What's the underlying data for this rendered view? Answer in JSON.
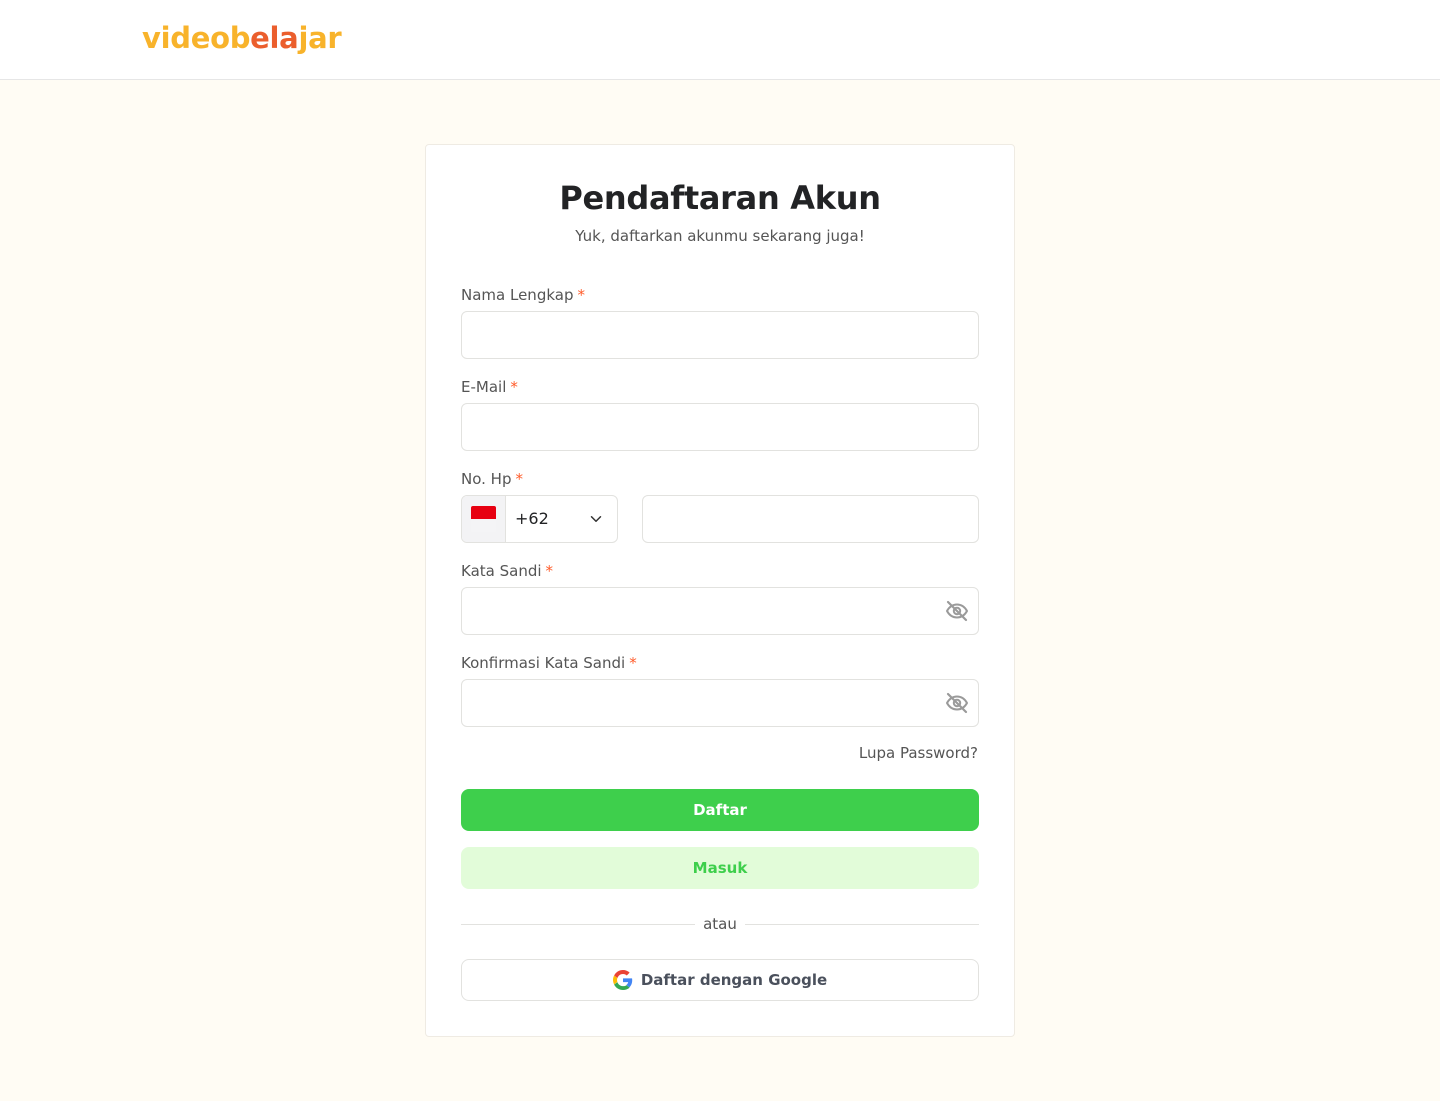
{
  "header": {
    "logo_part1": "videob",
    "logo_part2": "ela",
    "logo_part3": "jar"
  },
  "form": {
    "title": "Pendaftaran Akun",
    "subtitle": "Yuk, daftarkan akunmu sekarang juga!",
    "required_mark": "*",
    "fields": {
      "full_name": {
        "label": "Nama Lengkap",
        "value": ""
      },
      "email": {
        "label": "E-Mail",
        "value": ""
      },
      "phone": {
        "label": "No. Hp",
        "country_code": "+62",
        "value": ""
      },
      "password": {
        "label": "Kata Sandi",
        "value": ""
      },
      "confirm_password": {
        "label": "Konfirmasi Kata Sandi",
        "value": ""
      }
    },
    "forgot_password": "Lupa Password?",
    "register_button": "Daftar",
    "login_button": "Masuk",
    "divider_text": "atau",
    "google_button": "Daftar dengan Google"
  },
  "colors": {
    "page_bg": "#FFFCF4",
    "primary_green": "#3ECF4C",
    "secondary_green_bg": "#E2FCD9",
    "logo_orange": "#F8B32B",
    "logo_red_orange": "#EB5E2D",
    "required": "#FF5C2B"
  },
  "icons": {
    "password_toggle": "eye-off-icon",
    "dropdown": "chevron-down-icon",
    "flag": "indonesia-flag-icon",
    "google": "google-icon"
  }
}
